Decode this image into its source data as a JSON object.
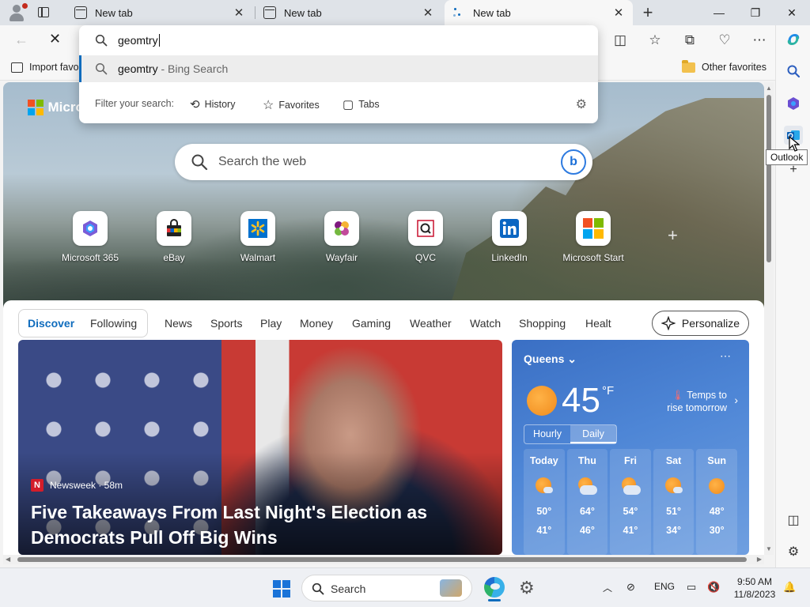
{
  "browser": {
    "tabs": [
      {
        "title": "New tab",
        "active": false
      },
      {
        "title": "New tab",
        "active": false
      },
      {
        "title": "New tab",
        "active": true,
        "loading": true
      }
    ],
    "window_controls": [
      "minimize",
      "restore",
      "close"
    ]
  },
  "address_bar": {
    "query": "geomtry",
    "suggestion": {
      "text": "geomtry",
      "suffix": " - Bing Search"
    },
    "filter_label": "Filter your search:",
    "filters": [
      "History",
      "Favorites",
      "Tabs"
    ]
  },
  "favorites_bar": {
    "import_label": "Import favo",
    "other_label": "Other favorites"
  },
  "new_tab_page": {
    "brand": "Micro",
    "search_placeholder": "Search the web",
    "quick_links": [
      {
        "label": "Microsoft 365",
        "icon": "microsoft365-icon"
      },
      {
        "label": "eBay",
        "icon": "ebay-icon"
      },
      {
        "label": "Walmart",
        "icon": "walmart-icon"
      },
      {
        "label": "Wayfair",
        "icon": "wayfair-icon"
      },
      {
        "label": "QVC",
        "icon": "qvc-icon"
      },
      {
        "label": "LinkedIn",
        "icon": "linkedin-icon"
      },
      {
        "label": "Microsoft Start",
        "icon": "microsoft-start-icon"
      }
    ],
    "feed_tabs": [
      "Discover",
      "Following",
      "News",
      "Sports",
      "Play",
      "Money",
      "Gaming",
      "Weather",
      "Watch",
      "Shopping",
      "Healt"
    ],
    "personalize_label": "Personalize",
    "story": {
      "source": "Newsweek · 58m",
      "headline": "Five Takeaways From Last Night's Election as Democrats Pull Off Big Wins"
    },
    "weather": {
      "location": "Queens",
      "temp": "45",
      "unit": "°F",
      "alert": "Temps to rise tomorrow",
      "toggle": [
        "Hourly",
        "Daily"
      ],
      "days": [
        {
          "name": "Today",
          "hi": "50°",
          "lo": "41°",
          "icon": "sun-cloud-icon"
        },
        {
          "name": "Thu",
          "hi": "64°",
          "lo": "46°",
          "icon": "cloud-sun-icon"
        },
        {
          "name": "Fri",
          "hi": "54°",
          "lo": "41°",
          "icon": "cloud-sun-icon"
        },
        {
          "name": "Sat",
          "hi": "51°",
          "lo": "34°",
          "icon": "sun-cloud-icon"
        },
        {
          "name": "Sun",
          "hi": "48°",
          "lo": "30°",
          "icon": "sun-icon"
        }
      ]
    }
  },
  "sidebar": {
    "tooltip": "Outlook",
    "items": [
      "search-icon",
      "copilot-icon",
      "outlook-icon",
      "add-icon",
      "split-screen-icon",
      "settings-icon"
    ]
  },
  "taskbar": {
    "search_label": "Search",
    "language": "ENG",
    "time": "9:50 AM",
    "date": "11/8/2023"
  },
  "colors": {
    "accent": "#0f6cbd",
    "weather_card": "#4e86d6",
    "news_badge": "#d31d2a"
  }
}
